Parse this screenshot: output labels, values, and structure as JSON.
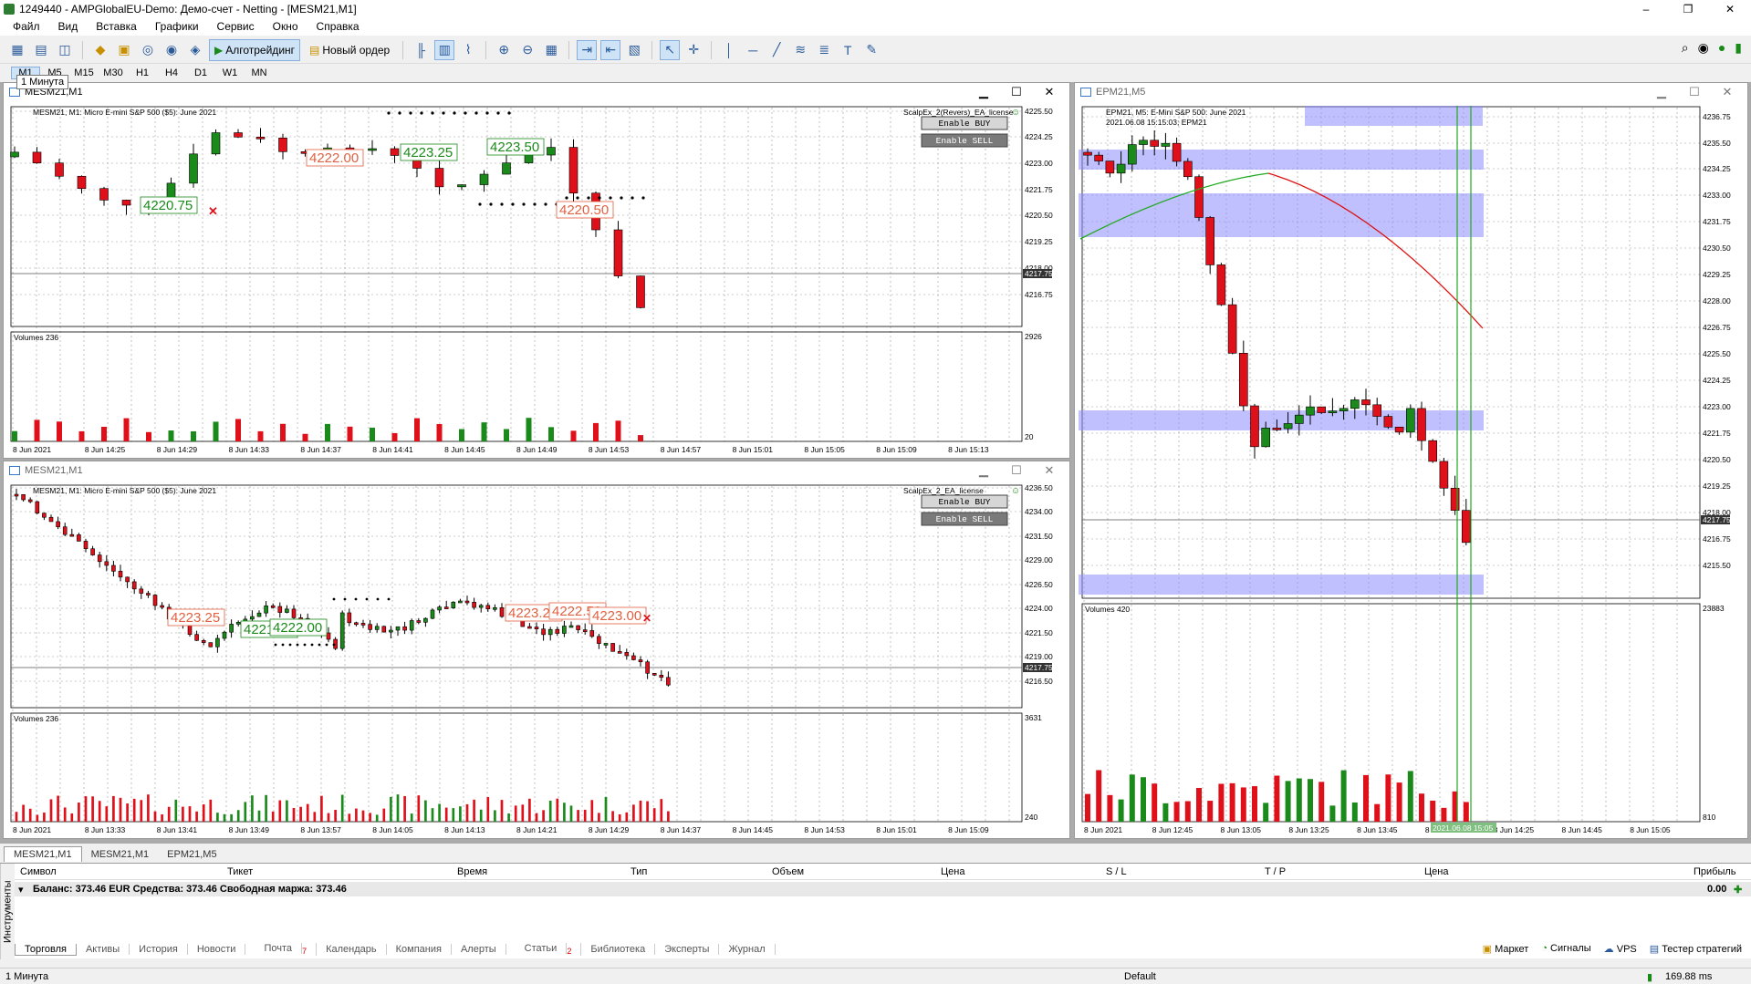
{
  "app": {
    "title": "1249440 - AMPGlobalEU-Demo: Демо-счет - Netting - [MESM21,M1]",
    "window_controls": [
      "–",
      "❐",
      "✕"
    ]
  },
  "menu": [
    "Файл",
    "Вид",
    "Вставка",
    "Графики",
    "Сервис",
    "Окно",
    "Справка"
  ],
  "toolbar": {
    "algo_label": "Алготрейдинг",
    "order_label": "Новый ордер"
  },
  "timeframes": [
    "M1",
    "M5",
    "M15",
    "M30",
    "H1",
    "H4",
    "D1",
    "W1",
    "MN"
  ],
  "active_timeframe": "M1",
  "tooltip": "1 Минута",
  "windows": {
    "w1": {
      "title": "MESM21,M1",
      "info": "MESM21, M1:  Micro E-mini S&P 500 ($5): June 2021",
      "ea": "ScalpEx_2(Revers)_EA_license",
      "btn_buy": "Enable  BUY",
      "btn_sell": "Enable  SELL",
      "volumes_label": "Volumes 236",
      "vol_top": "2926",
      "vol_bot": "20",
      "price_labels": [
        "4225.50",
        "4224.25",
        "4223.00",
        "4221.75",
        "4220.50",
        "4219.25",
        "4218.00",
        "4216.75"
      ],
      "current_price": "4217.75",
      "time_labels": [
        "8 Jun 2021",
        "8 Jun 14:25",
        "8 Jun 14:29",
        "8 Jun 14:33",
        "8 Jun 14:37",
        "8 Jun 14:41",
        "8 Jun 14:45",
        "8 Jun 14:49",
        "8 Jun 14:53",
        "8 Jun 14:57",
        "8 Jun 15:01",
        "8 Jun 15:05",
        "8 Jun 15:09",
        "8 Jun 15:13"
      ],
      "annotations": [
        "4220.75",
        "4223.25",
        "4223.50",
        "4222.00",
        "4220.50"
      ]
    },
    "w2": {
      "title": "MESM21,M1",
      "info": "MESM21, M1:  Micro E-mini S&P 500 ($5): June 2021",
      "ea": "ScalpEx_2_EA_license",
      "btn_buy": "Enable  BUY",
      "btn_sell": "Enable  SELL",
      "volumes_label": "Volumes 236",
      "vol_top": "3631",
      "vol_bot": "240",
      "price_labels": [
        "4236.50",
        "4234.00",
        "4231.50",
        "4229.00",
        "4226.50",
        "4224.00",
        "4221.50",
        "4219.00",
        "4216.50"
      ],
      "current_price": "4217.75",
      "time_labels": [
        "8 Jun 2021",
        "8 Jun 13:33",
        "8 Jun 13:41",
        "8 Jun 13:49",
        "8 Jun 13:57",
        "8 Jun 14:05",
        "8 Jun 14:13",
        "8 Jun 14:21",
        "8 Jun 14:29",
        "8 Jun 14:37",
        "8 Jun 14:45",
        "8 Jun 14:53",
        "8 Jun 15:01",
        "8 Jun 15:09"
      ],
      "annotations": [
        "4223.25",
        "4221.75",
        "4222.00",
        "4223.25",
        "4222.50",
        "4223.00"
      ]
    },
    "w3": {
      "title": "EPM21,M5",
      "info": "EPM21, M5:  E-Mini S&P 500: June 2021",
      "info2": "2021.06.08 15:15:03; EPM21",
      "volumes_label": "Volumes 420",
      "vol_top": "23883",
      "vol_bot": "810",
      "price_labels": [
        "4236.75",
        "4235.50",
        "4234.25",
        "4233.00",
        "4231.75",
        "4230.50",
        "4229.25",
        "4228.00",
        "4226.75",
        "4225.50",
        "4224.25",
        "4223.00",
        "4221.75",
        "4220.50",
        "4219.25",
        "4218.00",
        "4216.75",
        "4215.50"
      ],
      "current_price": "4217.75",
      "time_labels": [
        "8 Jun 2021",
        "8 Jun 12:45",
        "8 Jun 13:05",
        "8 Jun 13:25",
        "8 Jun 13:45",
        "8 Jun 14:05",
        "8 Jun 14:25",
        "8 Jun 14:45",
        "8 Jun 15:05"
      ],
      "crosshair_time": "2021.06.08 15:05"
    }
  },
  "chart_tabs": [
    "MESM21,M1",
    "MESM21,M1",
    "EPM21,M5"
  ],
  "terminal": {
    "side_label": "Инструменты",
    "columns": [
      "Символ",
      "Тикет",
      "Время",
      "Тип",
      "Объем",
      "Цена",
      "S / L",
      "T / P",
      "Цена",
      "Прибыль"
    ],
    "balance": "Баланс: 373.46 EUR  Средства: 373.46  Свободная маржа: 373.46",
    "profit": "0.00",
    "tabs": [
      "Торговля",
      "Активы",
      "История",
      "Новости",
      "Почта",
      "Календарь",
      "Компания",
      "Алерты",
      "Статьи",
      "Библиотека",
      "Эксперты",
      "Журнал"
    ],
    "mail_count": "7",
    "articles_count": "2",
    "right_links": [
      "Маркет",
      "Сигналы",
      "VPS",
      "Тестер стратегий"
    ]
  },
  "status": {
    "left": "1 Минута",
    "profile": "Default",
    "ping": "169.88 ms"
  },
  "colors": {
    "bull": "#1a8a1a",
    "bear": "#e0101a",
    "zone": "#8c8cff",
    "ma_green": "#22aa22",
    "ma_red": "#dd1111"
  }
}
